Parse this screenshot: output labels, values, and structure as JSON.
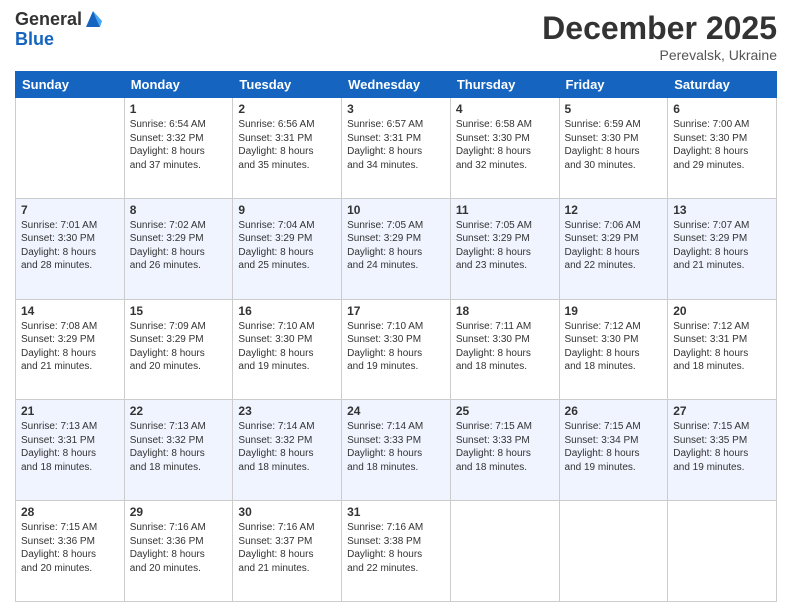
{
  "logo": {
    "general": "General",
    "blue": "Blue"
  },
  "title": "December 2025",
  "location": "Perevalsk, Ukraine",
  "days_of_week": [
    "Sunday",
    "Monday",
    "Tuesday",
    "Wednesday",
    "Thursday",
    "Friday",
    "Saturday"
  ],
  "weeks": [
    [
      {
        "day": "",
        "info": ""
      },
      {
        "day": "1",
        "info": "Sunrise: 6:54 AM\nSunset: 3:32 PM\nDaylight: 8 hours\nand 37 minutes."
      },
      {
        "day": "2",
        "info": "Sunrise: 6:56 AM\nSunset: 3:31 PM\nDaylight: 8 hours\nand 35 minutes."
      },
      {
        "day": "3",
        "info": "Sunrise: 6:57 AM\nSunset: 3:31 PM\nDaylight: 8 hours\nand 34 minutes."
      },
      {
        "day": "4",
        "info": "Sunrise: 6:58 AM\nSunset: 3:30 PM\nDaylight: 8 hours\nand 32 minutes."
      },
      {
        "day": "5",
        "info": "Sunrise: 6:59 AM\nSunset: 3:30 PM\nDaylight: 8 hours\nand 30 minutes."
      },
      {
        "day": "6",
        "info": "Sunrise: 7:00 AM\nSunset: 3:30 PM\nDaylight: 8 hours\nand 29 minutes."
      }
    ],
    [
      {
        "day": "7",
        "info": "Sunrise: 7:01 AM\nSunset: 3:30 PM\nDaylight: 8 hours\nand 28 minutes."
      },
      {
        "day": "8",
        "info": "Sunrise: 7:02 AM\nSunset: 3:29 PM\nDaylight: 8 hours\nand 26 minutes."
      },
      {
        "day": "9",
        "info": "Sunrise: 7:04 AM\nSunset: 3:29 PM\nDaylight: 8 hours\nand 25 minutes."
      },
      {
        "day": "10",
        "info": "Sunrise: 7:05 AM\nSunset: 3:29 PM\nDaylight: 8 hours\nand 24 minutes."
      },
      {
        "day": "11",
        "info": "Sunrise: 7:05 AM\nSunset: 3:29 PM\nDaylight: 8 hours\nand 23 minutes."
      },
      {
        "day": "12",
        "info": "Sunrise: 7:06 AM\nSunset: 3:29 PM\nDaylight: 8 hours\nand 22 minutes."
      },
      {
        "day": "13",
        "info": "Sunrise: 7:07 AM\nSunset: 3:29 PM\nDaylight: 8 hours\nand 21 minutes."
      }
    ],
    [
      {
        "day": "14",
        "info": "Sunrise: 7:08 AM\nSunset: 3:29 PM\nDaylight: 8 hours\nand 21 minutes."
      },
      {
        "day": "15",
        "info": "Sunrise: 7:09 AM\nSunset: 3:29 PM\nDaylight: 8 hours\nand 20 minutes."
      },
      {
        "day": "16",
        "info": "Sunrise: 7:10 AM\nSunset: 3:30 PM\nDaylight: 8 hours\nand 19 minutes."
      },
      {
        "day": "17",
        "info": "Sunrise: 7:10 AM\nSunset: 3:30 PM\nDaylight: 8 hours\nand 19 minutes."
      },
      {
        "day": "18",
        "info": "Sunrise: 7:11 AM\nSunset: 3:30 PM\nDaylight: 8 hours\nand 18 minutes."
      },
      {
        "day": "19",
        "info": "Sunrise: 7:12 AM\nSunset: 3:30 PM\nDaylight: 8 hours\nand 18 minutes."
      },
      {
        "day": "20",
        "info": "Sunrise: 7:12 AM\nSunset: 3:31 PM\nDaylight: 8 hours\nand 18 minutes."
      }
    ],
    [
      {
        "day": "21",
        "info": "Sunrise: 7:13 AM\nSunset: 3:31 PM\nDaylight: 8 hours\nand 18 minutes."
      },
      {
        "day": "22",
        "info": "Sunrise: 7:13 AM\nSunset: 3:32 PM\nDaylight: 8 hours\nand 18 minutes."
      },
      {
        "day": "23",
        "info": "Sunrise: 7:14 AM\nSunset: 3:32 PM\nDaylight: 8 hours\nand 18 minutes."
      },
      {
        "day": "24",
        "info": "Sunrise: 7:14 AM\nSunset: 3:33 PM\nDaylight: 8 hours\nand 18 minutes."
      },
      {
        "day": "25",
        "info": "Sunrise: 7:15 AM\nSunset: 3:33 PM\nDaylight: 8 hours\nand 18 minutes."
      },
      {
        "day": "26",
        "info": "Sunrise: 7:15 AM\nSunset: 3:34 PM\nDaylight: 8 hours\nand 19 minutes."
      },
      {
        "day": "27",
        "info": "Sunrise: 7:15 AM\nSunset: 3:35 PM\nDaylight: 8 hours\nand 19 minutes."
      }
    ],
    [
      {
        "day": "28",
        "info": "Sunrise: 7:15 AM\nSunset: 3:36 PM\nDaylight: 8 hours\nand 20 minutes."
      },
      {
        "day": "29",
        "info": "Sunrise: 7:16 AM\nSunset: 3:36 PM\nDaylight: 8 hours\nand 20 minutes."
      },
      {
        "day": "30",
        "info": "Sunrise: 7:16 AM\nSunset: 3:37 PM\nDaylight: 8 hours\nand 21 minutes."
      },
      {
        "day": "31",
        "info": "Sunrise: 7:16 AM\nSunset: 3:38 PM\nDaylight: 8 hours\nand 22 minutes."
      },
      {
        "day": "",
        "info": ""
      },
      {
        "day": "",
        "info": ""
      },
      {
        "day": "",
        "info": ""
      }
    ]
  ]
}
